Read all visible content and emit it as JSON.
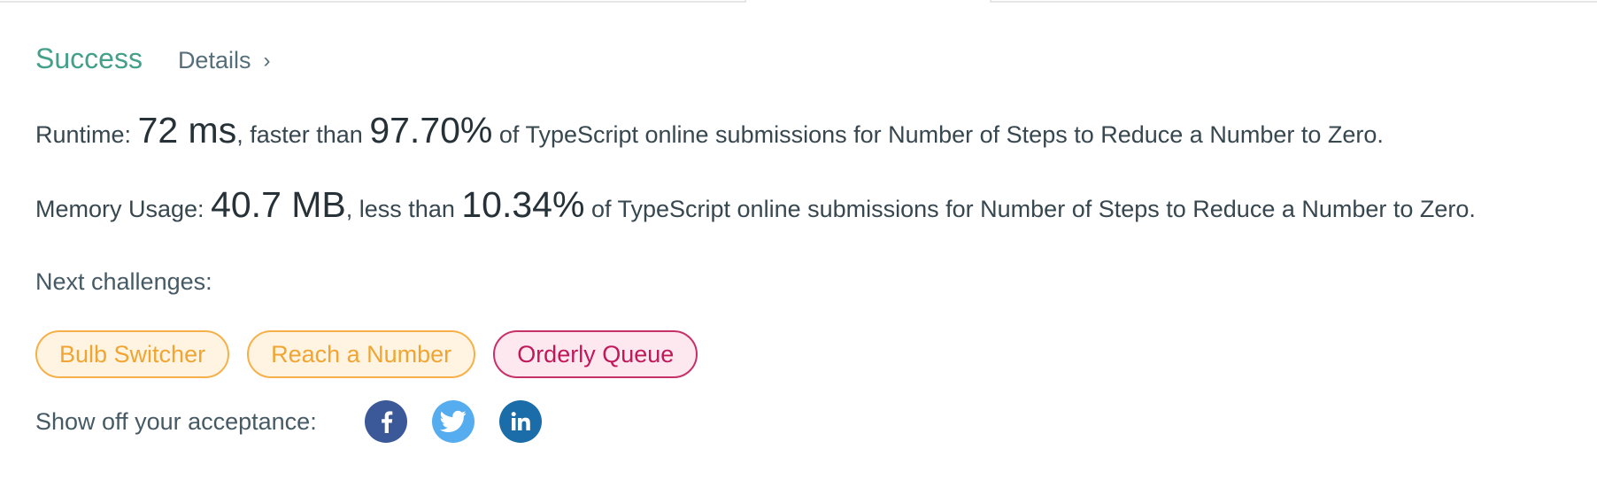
{
  "result": {
    "status": "Success",
    "details_label": "Details",
    "details_chevron": "›"
  },
  "runtime": {
    "label": "Runtime:",
    "value": "72 ms",
    "comparison": ", faster than",
    "percent": "97.70%",
    "suffix": "of TypeScript online submissions for Number of Steps to Reduce a Number to Zero."
  },
  "memory": {
    "label": "Memory Usage:",
    "value": "40.7 MB",
    "comparison": ", less than",
    "percent": "10.34%",
    "suffix": "of TypeScript online submissions for Number of Steps to Reduce a Number to Zero."
  },
  "next_challenges": {
    "label": "Next challenges:",
    "items": [
      {
        "label": "Bulb Switcher",
        "difficulty": "medium",
        "color": "#f0a532"
      },
      {
        "label": "Reach a Number",
        "difficulty": "medium",
        "color": "#f0a532"
      },
      {
        "label": "Orderly Queue",
        "difficulty": "hard",
        "color": "#c0185a"
      }
    ]
  },
  "share": {
    "label": "Show off your acceptance:",
    "icons": [
      {
        "name": "facebook-icon",
        "color": "#3b5998"
      },
      {
        "name": "twitter-icon",
        "color": "#55acee"
      },
      {
        "name": "linkedin-icon",
        "color": "#1a6da8"
      }
    ]
  },
  "colors": {
    "success": "#43a08a",
    "text": "#37474f"
  }
}
